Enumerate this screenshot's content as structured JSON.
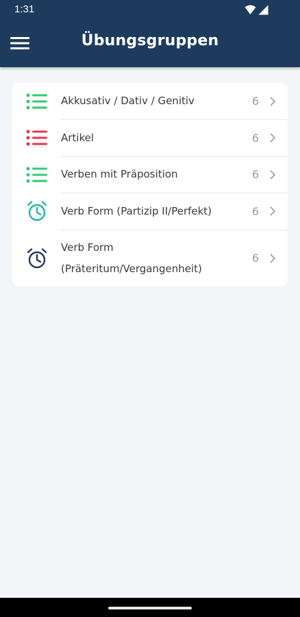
{
  "status_bar": {
    "time": "1:31",
    "icons": [
      "wifi-icon",
      "signal-icon"
    ]
  },
  "app_bar": {
    "title": "Übungsgruppen",
    "menu_icon": "hamburger-menu-icon"
  },
  "groups": [
    {
      "label": "Akkusativ / Dativ / Genitiv",
      "count": "6",
      "icon": "list-icon",
      "icon_color": "#2ecc71"
    },
    {
      "label": "Artikel",
      "count": "6",
      "icon": "list-icon",
      "icon_color": "#e8344a"
    },
    {
      "label": "Verben mit Präposition",
      "count": "6",
      "icon": "list-icon",
      "icon_color": "#2ecc71"
    },
    {
      "label": "Verb Form (Partizip II/Perfekt)",
      "count": "6",
      "icon": "alarm-clock-icon",
      "icon_color": "#1fb5a8"
    },
    {
      "label": "Verb Form (Präteritum/Vergangenheit)",
      "count": "6",
      "icon": "alarm-clock-icon",
      "icon_color": "#1d3b5c"
    }
  ],
  "colors": {
    "app_bar": "#1d3b5c",
    "background": "#f3f5f9"
  }
}
